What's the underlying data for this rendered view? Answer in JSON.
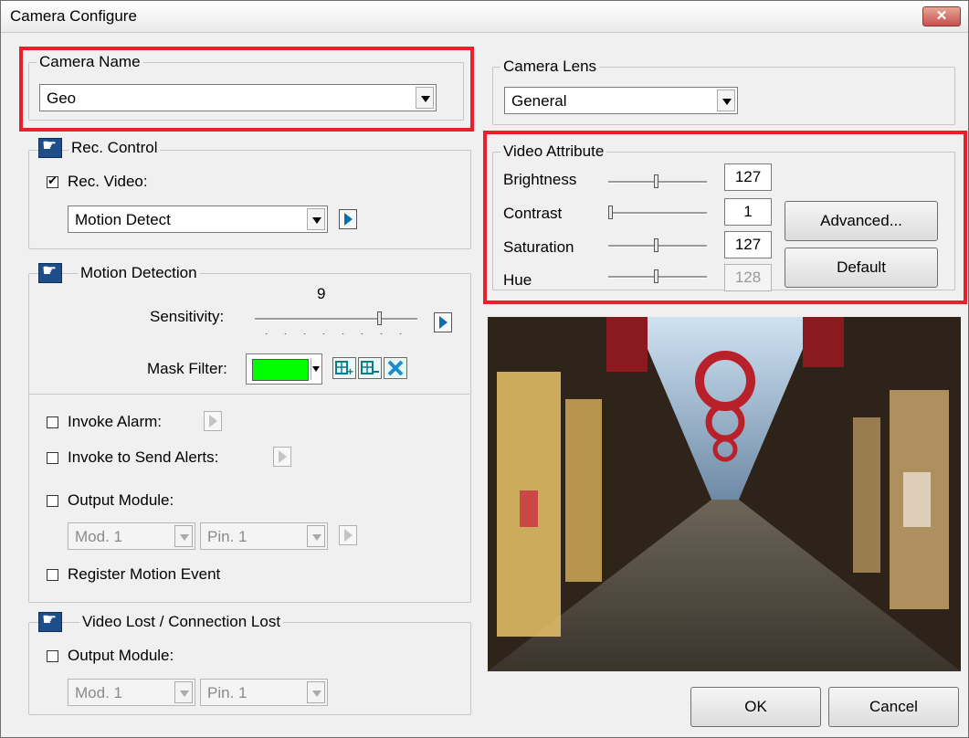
{
  "window": {
    "title": "Camera Configure",
    "close_label": "✕"
  },
  "camera_name": {
    "label": "Camera Name",
    "value": "Geo"
  },
  "camera_lens": {
    "label": "Camera Lens",
    "value": "General"
  },
  "rec_control": {
    "label": "Rec. Control",
    "rec_video_label": "Rec. Video:",
    "rec_video_checked": true,
    "mode_value": "Motion Detect"
  },
  "motion_detection": {
    "label": "Motion Detection",
    "sensitivity_value": "9",
    "sensitivity_label": "Sensitivity:",
    "sensitivity_level": 0.78,
    "mask_filter_label": "Mask Filter:",
    "mask_color": "#00ff00",
    "invoke_alarm_label": "Invoke Alarm:",
    "invoke_alerts_label": "Invoke to Send Alerts:",
    "output_module_label": "Output Module:",
    "module_value": "Mod. 1",
    "pin_value": "Pin. 1",
    "register_label": "Register Motion Event"
  },
  "video_lost": {
    "label": "Video Lost / Connection Lost",
    "output_module_label": "Output Module:",
    "module_value": "Mod. 1",
    "pin_value": "Pin. 1"
  },
  "video_attribute": {
    "label": "Video Attribute",
    "brightness_label": "Brightness",
    "brightness_value": "127",
    "contrast_label": "Contrast",
    "contrast_value": "1",
    "saturation_label": "Saturation",
    "saturation_value": "127",
    "hue_label": "Hue",
    "hue_value": "128",
    "advanced_label": "Advanced...",
    "default_label": "Default"
  },
  "buttons": {
    "ok": "OK",
    "cancel": "Cancel"
  },
  "colors": {
    "highlight": "#e8202a",
    "accent": "#0b6fa8"
  }
}
